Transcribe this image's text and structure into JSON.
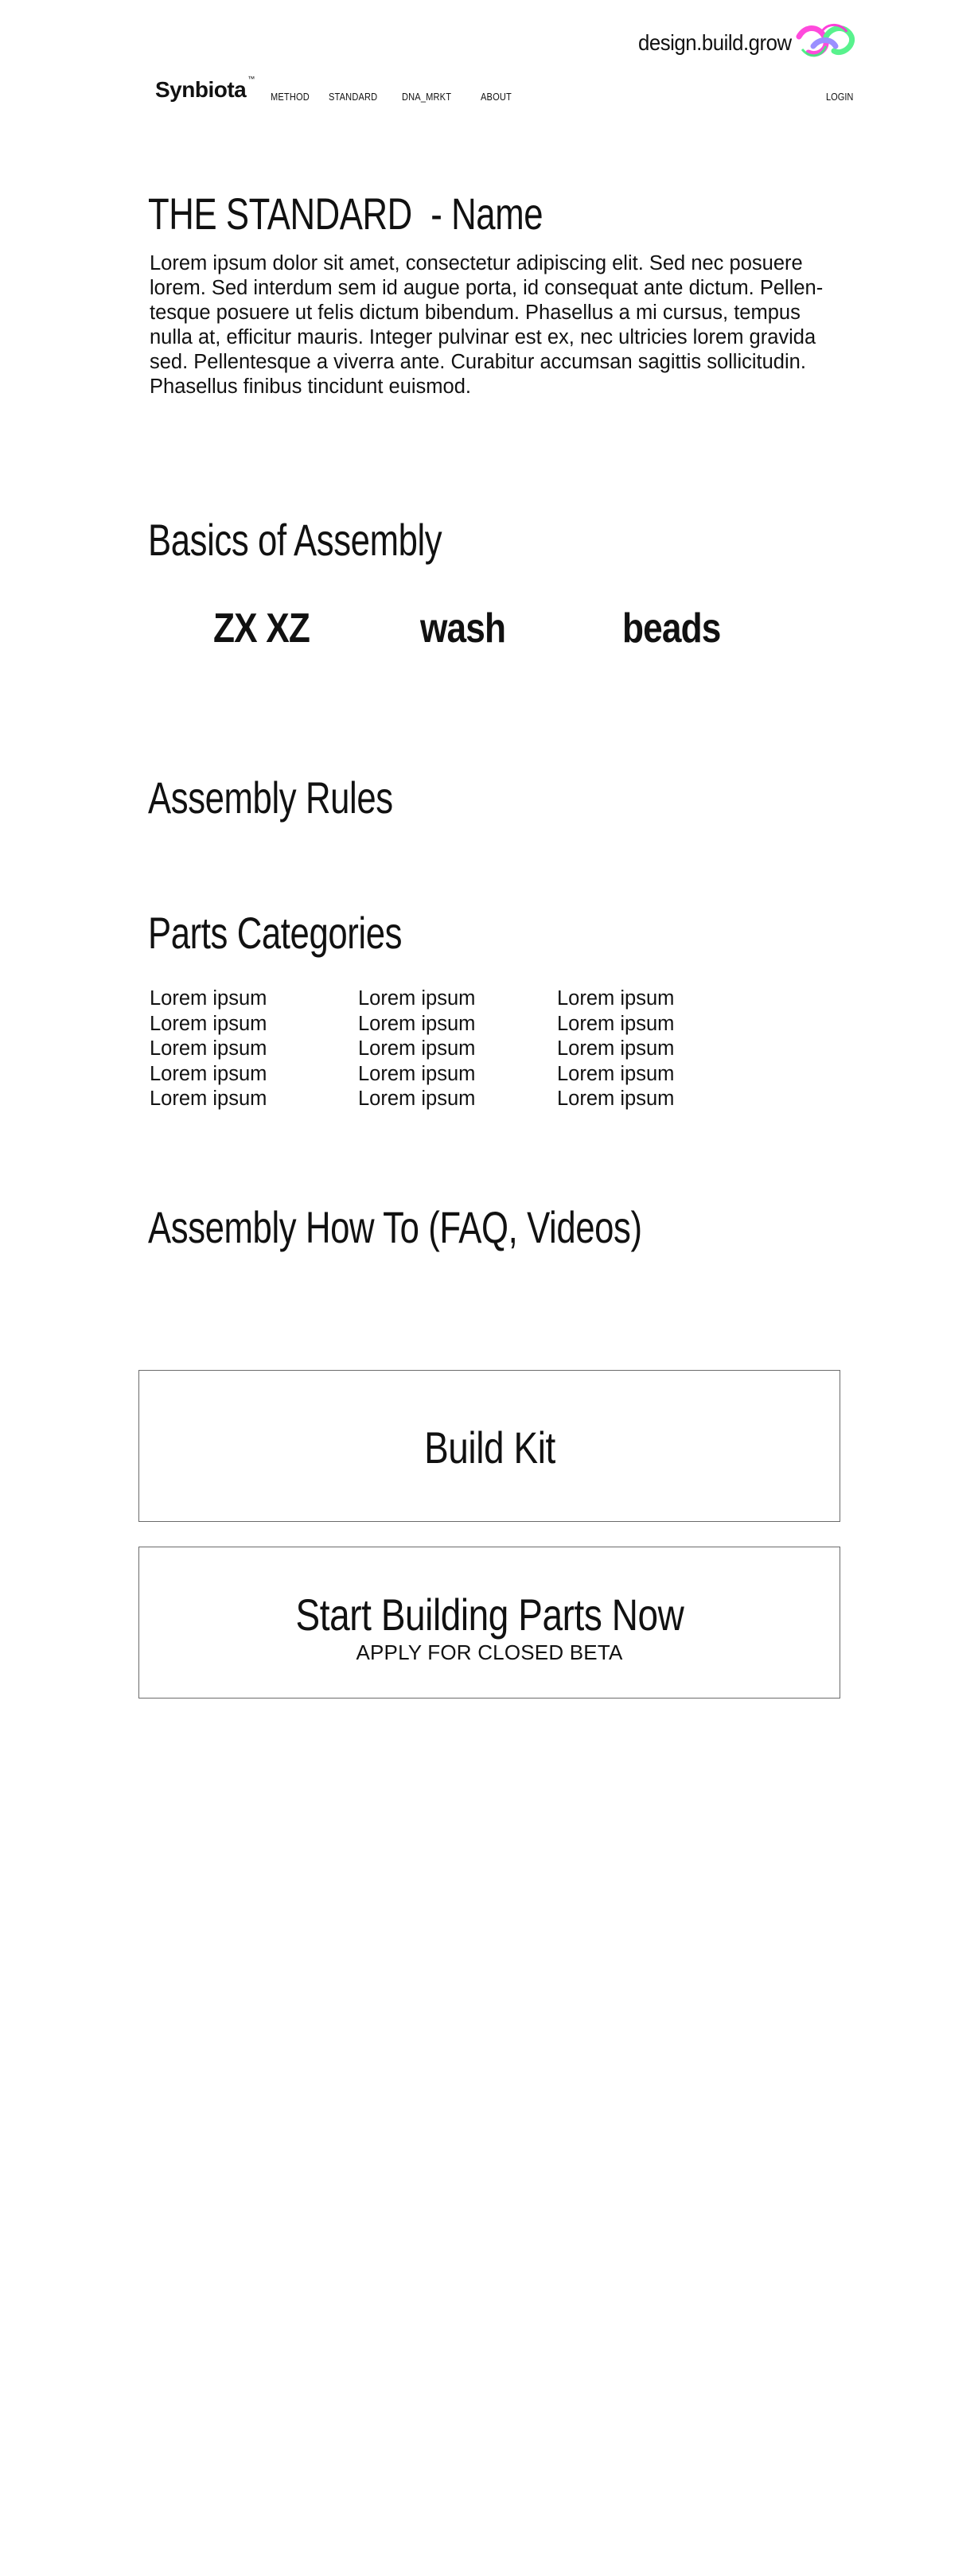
{
  "header": {
    "tagline": "design.build.grow",
    "brand": "Synbiota",
    "brand_mark": "™",
    "nav": [
      "METHOD",
      "STANDARD",
      "DNA_MRKT",
      "ABOUT"
    ],
    "login": "LOGIN",
    "logo_colors": [
      "#ff2bd6",
      "#3cf07a",
      "#8a7cff"
    ]
  },
  "page": {
    "title": "THE STANDARD",
    "title_suffix": "- Name",
    "intro_lines": [
      "Lorem ipsum dolor sit amet, consectetur adipiscing elit. Sed nec posuere",
      "lorem. Sed interdum sem id augue porta, id consequat ante dictum. Pellen-",
      "tesque posuere ut felis dictum bibendum. Phasellus a mi cursus, tempus",
      "nulla at, efficitur mauris. Integer pulvinar est ex, nec ultricies lorem gravida",
      "sed. Pellentesque a viverra ante. Curabitur accumsan sagittis sollicitudin.",
      "Phasellus finibus tincidunt euismod."
    ]
  },
  "basics": {
    "heading": "Basics of Assembly",
    "items": [
      "ZX XZ",
      "wash",
      "beads"
    ]
  },
  "rules": {
    "heading": "Assembly Rules"
  },
  "parts": {
    "heading": "Parts Categories",
    "columns": [
      [
        "Lorem ipsum",
        "Lorem ipsum",
        "Lorem ipsum",
        "Lorem ipsum",
        "Lorem ipsum"
      ],
      [
        "Lorem ipsum",
        "Lorem ipsum",
        "Lorem ipsum",
        "Lorem ipsum",
        "Lorem ipsum"
      ],
      [
        "Lorem ipsum",
        "Lorem ipsum",
        "Lorem ipsum",
        "Lorem ipsum",
        "Lorem ipsum"
      ]
    ]
  },
  "howto": {
    "heading": "Assembly How To (FAQ, Videos)"
  },
  "cta": {
    "build_kit": "Build Kit",
    "start_title": "Start Building Parts Now",
    "start_sub": "APPLY FOR CLOSED BETA"
  }
}
